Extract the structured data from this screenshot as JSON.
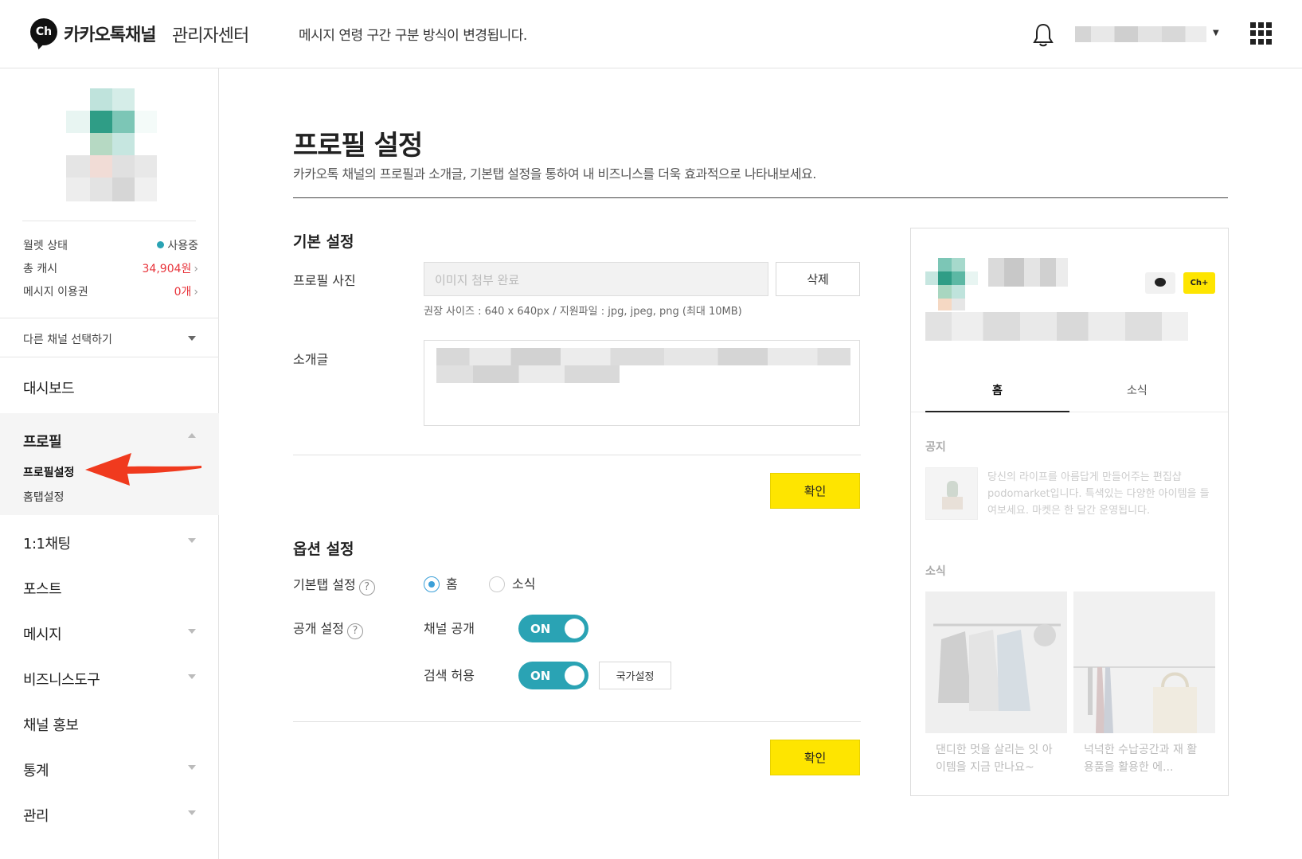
{
  "header": {
    "logo_badge": "Ch",
    "logo_title": "카카오톡채널",
    "logo_sub": "관리자센터",
    "notice": "메시지 연령 구간 구분 방식이 변경됩니다.",
    "icons": [
      "bell-icon",
      "apps-grid-icon"
    ]
  },
  "sidebar": {
    "stats": [
      {
        "label": "월렛 상태",
        "value": "사용중"
      },
      {
        "label": "총 캐시",
        "value": "34,904원"
      },
      {
        "label": "메시지 이용권",
        "value": "0개"
      }
    ],
    "select_channel": "다른 채널 선택하기",
    "menu": {
      "dashboard": "대시보드",
      "profile": "프로필",
      "profile_settings": "프로필설정",
      "hometab_settings": "홈탭설정",
      "chat": "1:1채팅",
      "post": "포스트",
      "message": "메시지",
      "business_tools": "비즈니스도구",
      "channel_promo": "채널 홍보",
      "stats": "통계",
      "manage": "관리"
    }
  },
  "main": {
    "title": "프로필 설정",
    "description": "카카오톡 채널의 프로필과 소개글, 기본탭 설정을 통하여 내 비즈니스를 더욱 효과적으로 나타내보세요.",
    "basic": {
      "title": "기본 설정",
      "photo_label": "프로필 사진",
      "photo_placeholder": "이미지 첨부 완료",
      "delete_button": "삭제",
      "hint": "권장 사이즈 : 640 x 640px / 지원파일 : jpg, jpeg, png (최대 10MB)",
      "intro_label": "소개글",
      "confirm_button": "확인"
    },
    "options": {
      "title": "옵션 설정",
      "default_tab_label": "기본탭 설정",
      "help_glyph": "?",
      "tab_home": "홈",
      "tab_news": "소식",
      "public_label": "공개 설정",
      "channel_public_label": "채널 공개",
      "search_allow_label": "검색 허용",
      "toggle_on": "ON",
      "country_button": "국가설정",
      "confirm_button": "확인"
    }
  },
  "preview": {
    "tab_home": "홈",
    "tab_news": "소식",
    "add_badge": "Ch+",
    "notice_title": "공지",
    "notice_text": "당신의 라이프를 아름답게 만들어주는 편집샵 podomarket입니다. 특색있는 다양한 아이템을 들여보세요. 마켓은 한 달간 운영됩니다.",
    "news_title": "소식",
    "cards": [
      {
        "caption": "댄디한 멋을 살리는 잇 아이템을 지금 만나요~"
      },
      {
        "caption": "넉넉한 수납공간과 재 활용품을 활용한 에..."
      }
    ]
  },
  "colors": {
    "accent_yellow": "#fee500",
    "teal": "#2aa3b4",
    "radio_blue": "#3a9fd8",
    "cash_red": "#e8343b",
    "annotation_arrow": "#f03a1e"
  }
}
